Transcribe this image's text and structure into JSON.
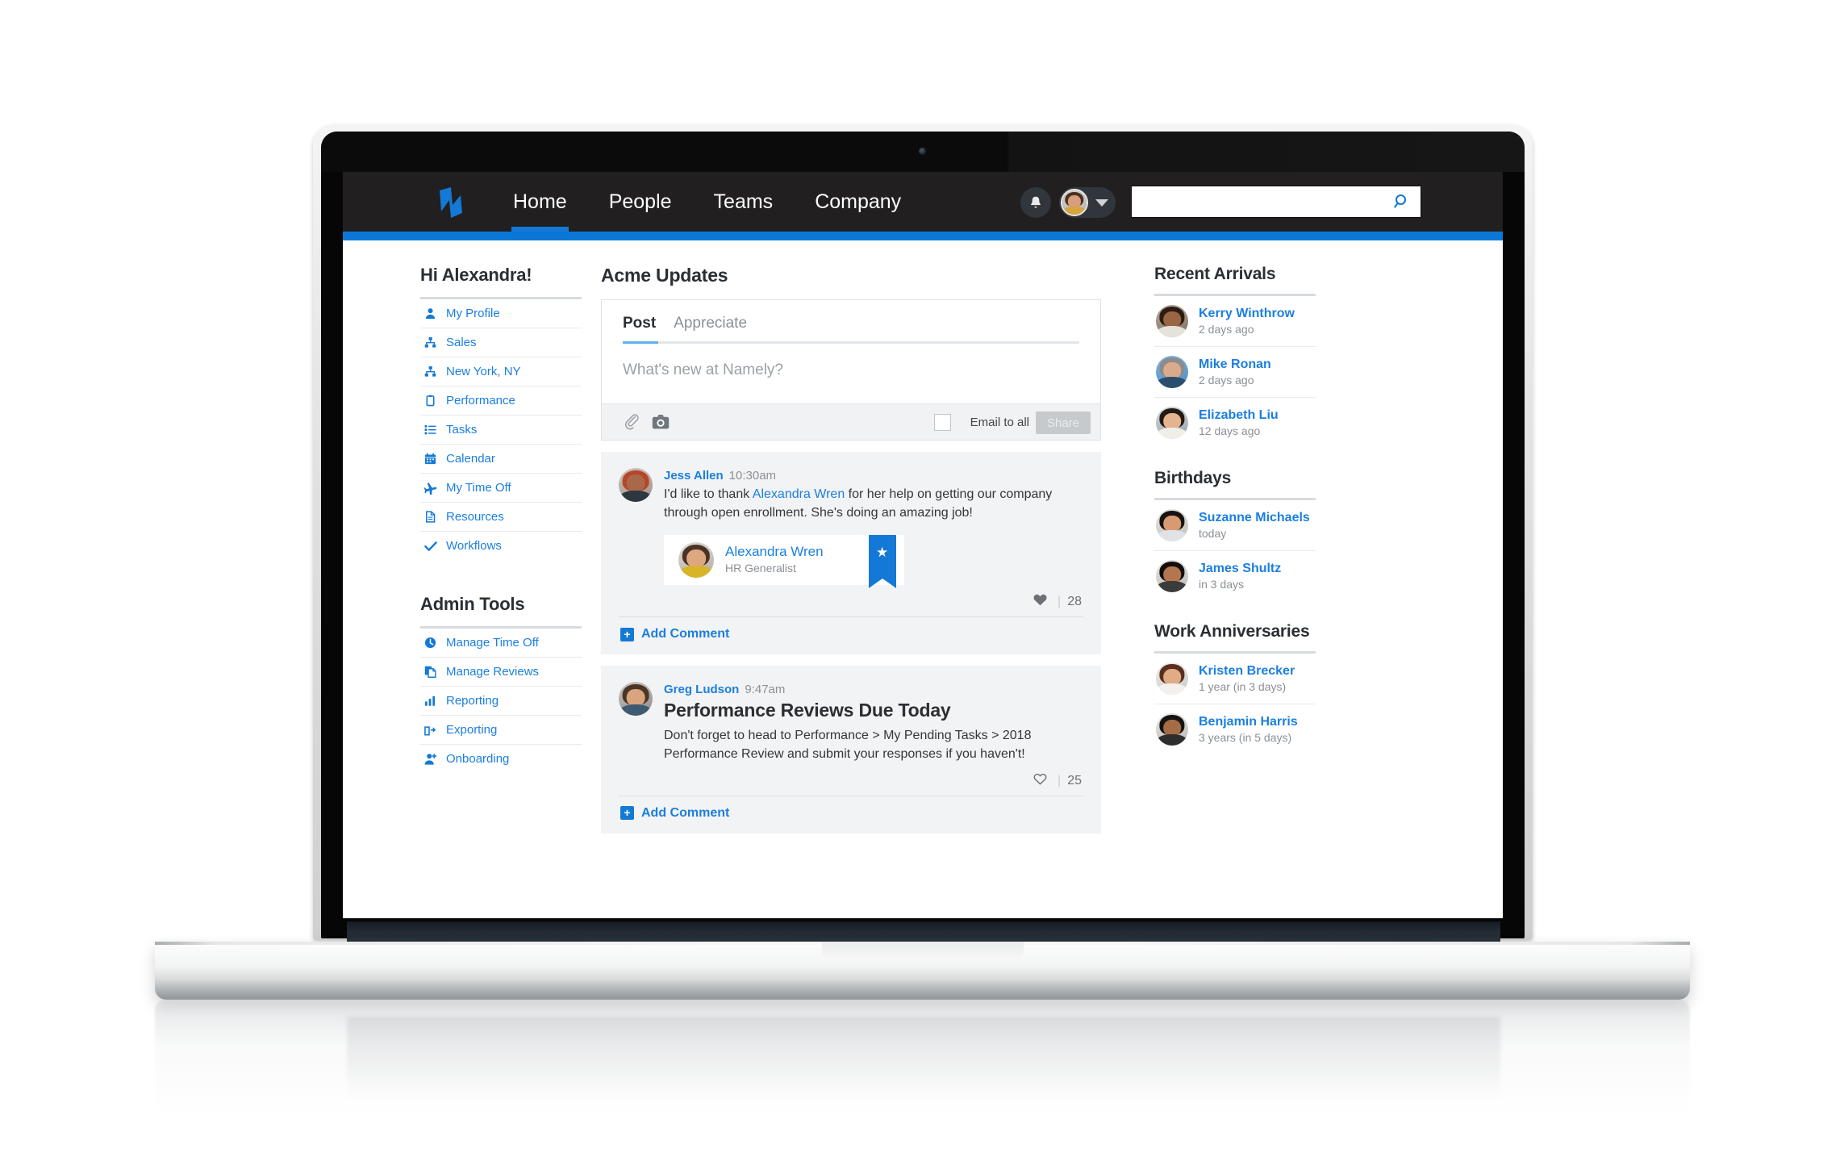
{
  "topnav": {
    "logo": "namely-logo-icon",
    "links": [
      {
        "label": "Home",
        "active": true
      },
      {
        "label": "People",
        "active": false
      },
      {
        "label": "Teams",
        "active": false
      },
      {
        "label": "Company",
        "active": false
      }
    ],
    "bell": "bell-icon",
    "avatar": "user-avatar",
    "caret": "chevron-down-icon",
    "search": {
      "value": "",
      "placeholder": "",
      "icon": "search-icon"
    },
    "accent_color": "#0c76d6",
    "bar_color": "#211f1f"
  },
  "left": {
    "greeting": "Hi Alexandra!",
    "items": [
      {
        "label": "My Profile",
        "icon": "person-icon"
      },
      {
        "label": "Sales",
        "icon": "org-chart-icon"
      },
      {
        "label": "New York, NY",
        "icon": "org-chart-icon"
      },
      {
        "label": "Performance",
        "icon": "clipboard-icon"
      },
      {
        "label": "Tasks",
        "icon": "list-icon"
      },
      {
        "label": "Calendar",
        "icon": "calendar-icon"
      },
      {
        "label": "My Time Off",
        "icon": "airplane-icon"
      },
      {
        "label": "Resources",
        "icon": "document-icon"
      },
      {
        "label": "Workflows",
        "icon": "check-icon"
      }
    ],
    "admin_title": "Admin Tools",
    "admin_items": [
      {
        "label": "Manage Time Off",
        "icon": "clock-icon"
      },
      {
        "label": "Manage Reviews",
        "icon": "copy-document-icon"
      },
      {
        "label": "Reporting",
        "icon": "bar-chart-icon"
      },
      {
        "label": "Exporting",
        "icon": "export-icon"
      },
      {
        "label": "Onboarding",
        "icon": "add-person-icon"
      }
    ]
  },
  "feed": {
    "title": "Acme Updates",
    "composer": {
      "tabs": [
        {
          "label": "Post",
          "active": true
        },
        {
          "label": "Appreciate",
          "active": false
        }
      ],
      "placeholder": "What's new at Namely?",
      "value": "",
      "attach_icon": "paperclip-icon",
      "photo_icon": "camera-icon",
      "email_all_label": "Email to all",
      "email_all_checked": false,
      "share_label": "Share",
      "share_disabled": true
    },
    "posts": [
      {
        "author": "Jess Allen",
        "time": "10:30am",
        "avatar": "jess-allen-avatar",
        "title": "",
        "body_before": "I'd like to thank ",
        "body_mention": "Alexandra Wren",
        "body_after": " for her help on getting our company through open enrollment. She's doing an amazing job!",
        "shoutout": {
          "name": "Alexandra Wren",
          "role": "HR Generalist",
          "avatar": "alexandra-wren-avatar",
          "ribbon_icon": "star-icon"
        },
        "like_icon": "heart-filled-icon",
        "likes": "28",
        "comment_label": "Add Comment"
      },
      {
        "author": "Greg Ludson",
        "time": "9:47am",
        "avatar": "greg-ludson-avatar",
        "title": "Performance Reviews Due Today",
        "body_before": "Don't forget to head to Performance > My Pending Tasks > 2018 Performance Review and submit your responses if you haven't!",
        "body_mention": "",
        "body_after": "",
        "shoutout": null,
        "like_icon": "heart-outline-icon",
        "likes": "25",
        "comment_label": "Add Comment"
      }
    ]
  },
  "right": {
    "sections": [
      {
        "title": "Recent Arrivals",
        "rows": [
          {
            "name": "Kerry Winthrow",
            "sub": "2 days ago",
            "avatar": "kerry-winthrow-avatar"
          },
          {
            "name": "Mike Ronan",
            "sub": "2 days ago",
            "avatar": "mike-ronan-avatar"
          },
          {
            "name": "Elizabeth Liu",
            "sub": "12 days ago",
            "avatar": "elizabeth-liu-avatar"
          }
        ]
      },
      {
        "title": "Birthdays",
        "rows": [
          {
            "name": "Suzanne Michaels",
            "sub": "today",
            "avatar": "suzanne-michaels-avatar"
          },
          {
            "name": "James Shultz",
            "sub": "in 3 days",
            "avatar": "james-shultz-avatar"
          }
        ]
      },
      {
        "title": "Work Anniversaries",
        "rows": [
          {
            "name": "Kristen Brecker",
            "sub": "1 year (in 3 days)",
            "avatar": "kristen-brecker-avatar"
          },
          {
            "name": "Benjamin Harris",
            "sub": "3 years (in 5 days)",
            "avatar": "benjamin-harris-avatar"
          }
        ]
      }
    ]
  }
}
